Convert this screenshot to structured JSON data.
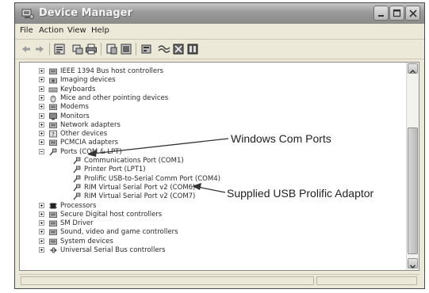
{
  "window": {
    "title": "Device Manager"
  },
  "menu": {
    "items": [
      "File",
      "Action",
      "View",
      "Help"
    ]
  },
  "toolbar": {
    "icons": [
      "back-icon",
      "forward-icon",
      "properties-icon",
      "scan-hardware-icon",
      "print-icon",
      "help-icon",
      "device-view-icon",
      "update-driver-icon",
      "uninstall-icon",
      "disable-icon",
      "enable-icon"
    ]
  },
  "tree": {
    "items": [
      {
        "label": "IEEE 1394 Bus host controllers",
        "icon": "ieee1394-icon",
        "expander": "+",
        "level": 0
      },
      {
        "label": "Imaging devices",
        "icon": "camera-icon",
        "expander": "+",
        "level": 0
      },
      {
        "label": "Keyboards",
        "icon": "keyboard-icon",
        "expander": "+",
        "level": 0
      },
      {
        "label": "Mice and other pointing devices",
        "icon": "mouse-icon",
        "expander": "+",
        "level": 0
      },
      {
        "label": "Modems",
        "icon": "modem-icon",
        "expander": "+",
        "level": 0
      },
      {
        "label": "Monitors",
        "icon": "monitor-icon",
        "expander": "+",
        "level": 0
      },
      {
        "label": "Network adapters",
        "icon": "network-adapter-icon",
        "expander": "+",
        "level": 0
      },
      {
        "label": "Other devices",
        "icon": "unknown-device-icon",
        "expander": "+",
        "level": 0
      },
      {
        "label": "PCMCIA adapters",
        "icon": "pcmcia-icon",
        "expander": "+",
        "level": 0
      },
      {
        "label": "Ports (COM & LPT)",
        "icon": "port-icon",
        "expander": "-",
        "level": 0
      },
      {
        "label": "Communications Port (COM1)",
        "icon": "port-icon",
        "expander": "",
        "level": 1
      },
      {
        "label": "Printer Port (LPT1)",
        "icon": "port-icon",
        "expander": "",
        "level": 1
      },
      {
        "label": "Prolific USB-to-Serial Comm Port (COM4)",
        "icon": "port-icon",
        "expander": "",
        "level": 1
      },
      {
        "label": "RIM Virtual Serial Port v2 (COM6)",
        "icon": "port-icon",
        "expander": "",
        "level": 1
      },
      {
        "label": "RIM Virtual Serial Port v2 (COM7)",
        "icon": "port-icon",
        "expander": "",
        "level": 1
      },
      {
        "label": "Processors",
        "icon": "processor-icon",
        "expander": "+",
        "level": 0
      },
      {
        "label": "Secure Digital host controllers",
        "icon": "sd-controller-icon",
        "expander": "+",
        "level": 0
      },
      {
        "label": "SM Driver",
        "icon": "sm-driver-icon",
        "expander": "+",
        "level": 0
      },
      {
        "label": "Sound, video and game controllers",
        "icon": "sound-icon",
        "expander": "+",
        "level": 0
      },
      {
        "label": "System devices",
        "icon": "system-device-icon",
        "expander": "+",
        "level": 0
      },
      {
        "label": "Universal Serial Bus controllers",
        "icon": "usb-icon",
        "expander": "+",
        "level": 0
      }
    ]
  },
  "annotations": {
    "com_ports": "Windows Com Ports",
    "usb_adaptor": "Supplied USB Prolific Adaptor"
  },
  "colors": {
    "titlebar": "#9a9a9a",
    "chrome": "#ece9d8",
    "text": "#2a2a2a"
  }
}
